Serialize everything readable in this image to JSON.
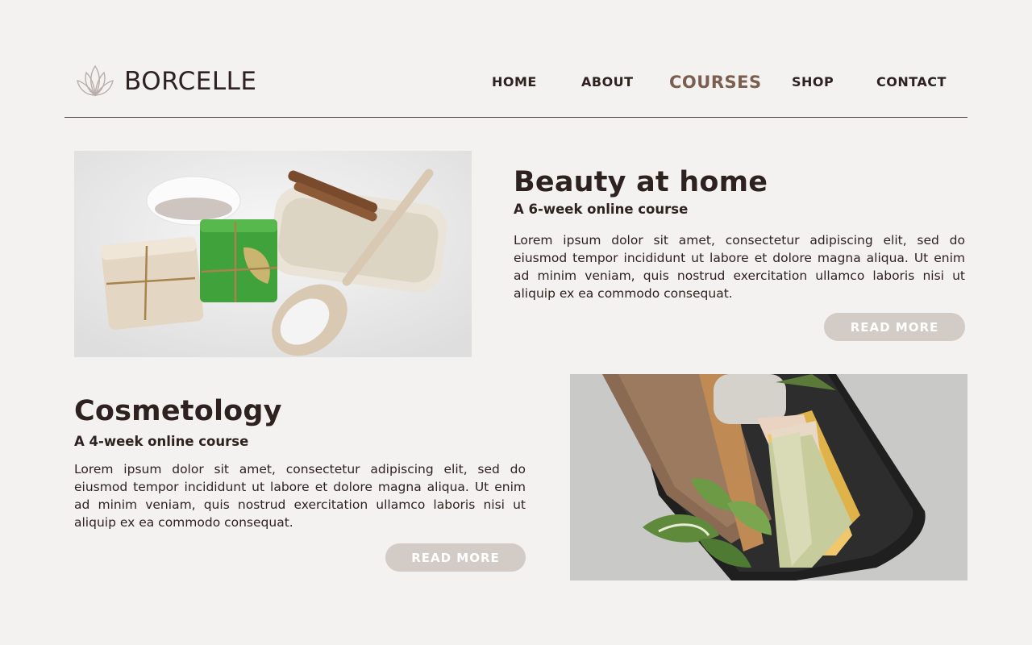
{
  "brand": {
    "name": "BORCELLE",
    "logo_icon": "lotus-icon"
  },
  "nav": {
    "items": [
      {
        "label": "HOME",
        "active": false
      },
      {
        "label": "ABOUT",
        "active": false
      },
      {
        "label": "COURSES",
        "active": true
      },
      {
        "label": "SHOP",
        "active": false
      },
      {
        "label": "CONTACT",
        "active": false
      }
    ]
  },
  "courses": [
    {
      "title": "Beauty at home",
      "subtitle": "A 6-week online course",
      "description": "Lorem ipsum dolor sit amet, consectetur adipiscing elit, sed do eiusmod tempor incididunt ut labore et dolore magna aliqua. Ut enim ad minim veniam, quis nostrud exercitation ullamco laboris nisi ut aliquip ex ea commodo consequat.",
      "button": "READ MORE"
    },
    {
      "title": "Cosmetology",
      "subtitle": "A 4-week online course",
      "description": "Lorem ipsum dolor sit amet, consectetur adipiscing elit, sed do eiusmod tempor incididunt ut labore et dolore magna aliqua. Ut enim ad minim veniam, quis nostrud exercitation ullamco laboris nisi ut aliquip ex ea commodo consequat.",
      "button": "READ MORE"
    }
  ],
  "colors": {
    "background": "#f4f2f0",
    "text": "#2e2220",
    "accent": "#7a5e50",
    "button": "#d3cbc5"
  }
}
